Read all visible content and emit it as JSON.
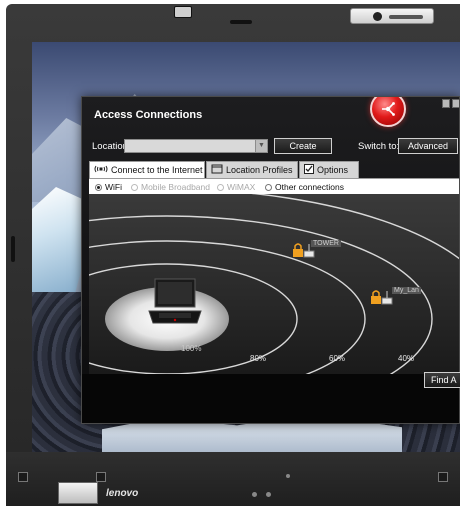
{
  "window": {
    "title": "Access Connections",
    "location_label": "Location:",
    "location_value": "",
    "create_button": "Create",
    "switch_label": "Switch to:",
    "advanced_button": "Advanced",
    "find_button": "Find A"
  },
  "tabs": [
    {
      "label": "Connect to the Internet",
      "active": true
    },
    {
      "label": "Location Profiles",
      "active": false
    },
    {
      "label": "Options",
      "active": false
    }
  ],
  "connection_types": {
    "wifi": "WiFi",
    "mobile_broadband": "Mobile Broadband",
    "wimax": "WiMAX",
    "other": "Other connections",
    "selected": "WiFi"
  },
  "map": {
    "rings": [
      "80%",
      "60%",
      "40%"
    ],
    "center_label": "100%",
    "networks": [
      {
        "name": "TOWER"
      },
      {
        "name": "My_Lan"
      }
    ]
  },
  "bezel": {
    "brand": "lenovo"
  },
  "colors": {
    "window_bg": "#0b0b0c",
    "accent_red": "#e11a1a",
    "lock_orange": "#f0a020"
  }
}
